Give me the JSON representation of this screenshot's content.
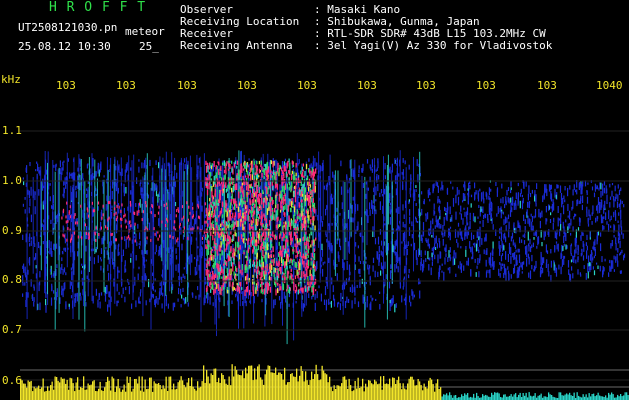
{
  "app": {
    "logo": "H R O F F T",
    "filename": "UT2508121030.pn",
    "mode": "meteor",
    "datetime": "25.08.12 10:30",
    "code": "25_"
  },
  "info": {
    "labels": [
      "Observer",
      "Receiving Location",
      "Receiver",
      "Receiving Antenna"
    ],
    "values": [
      ": Masaki Kano",
      ": Shibukawa, Gunma, Japan",
      ": RTL-SDR SDR# 43dB L15 103.2MHz CW",
      ": 3el Yagi(V) Az 330 for Vladivostok"
    ]
  },
  "axes": {
    "y_unit": "kHz",
    "y_ticks": [
      "1.1",
      "1.0",
      "0.9",
      "0.8",
      "0.7",
      "0.6"
    ],
    "x_ticks": [
      "103",
      "103",
      "103",
      "103",
      "103",
      "103",
      "103",
      "103",
      "103",
      "1040"
    ]
  },
  "colors": {
    "background": "#000000",
    "logo": "#2fe04a",
    "axis_labels": "#f2e52a",
    "header_text": "#ffffff",
    "signal_low": "#1a2bd6",
    "signal_mid": "#2ad4c8",
    "signal_high": "#ff2a78",
    "amplitude": "#f2e52a"
  }
}
